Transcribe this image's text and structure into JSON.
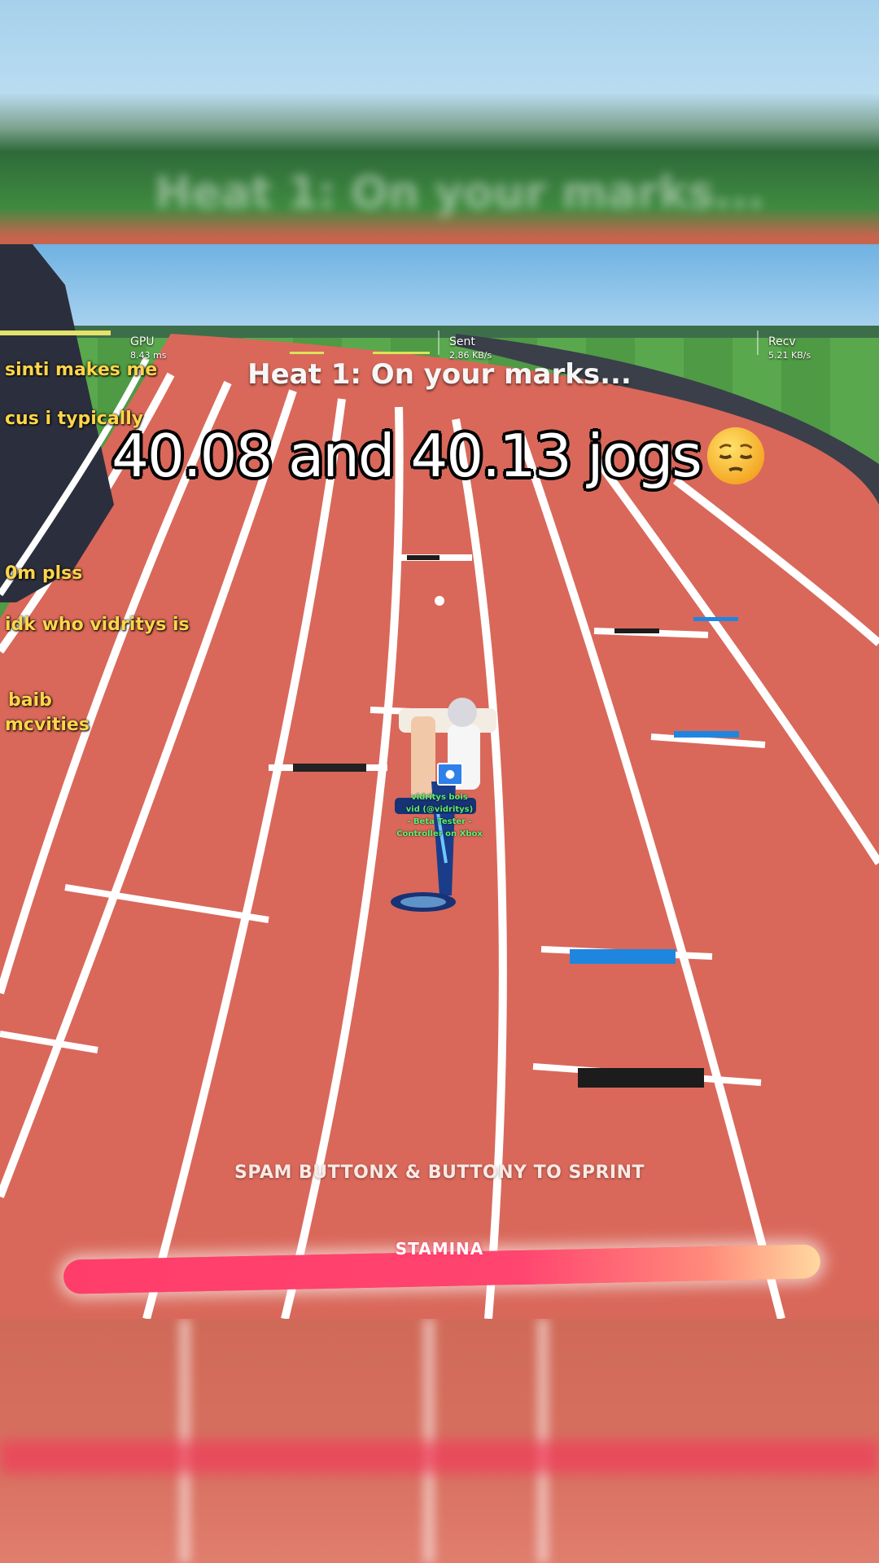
{
  "video": {
    "caption": "40.08 and 40.13 jogs",
    "caption_emoji": "relieved-face-emoji"
  },
  "blurred_header": {
    "ghost_text": "Heat 1: On your marks..."
  },
  "stats": {
    "gpu_label": "GPU",
    "gpu_value": "8.43 ms",
    "sent_label": "Sent",
    "sent_value": "2.86 KB/s",
    "recv_label": "Recv",
    "recv_value": "5.21 KB/s"
  },
  "game": {
    "heat_message": "Heat 1: On your marks...",
    "instruction": "SPAM BUTTONX & BUTTONY TO SPRINT",
    "stamina_label": "STAMINA"
  },
  "chat": [
    "sinti makes me",
    "cus i typically",
    "0m plss",
    "idk who vidritys is",
    "baib",
    "mcvities"
  ],
  "player": {
    "line1": "vidritys bois",
    "line2": "vid (@vidritys)",
    "line3": "- Beta Tester -",
    "line4": "Controller on Xbox",
    "badge_icon": "penguin-badge-icon"
  },
  "colors": {
    "track": "#d9685a",
    "lane_line": "#ffffff",
    "stamina": "#ff3d6a",
    "chat_text": "#ffd54a",
    "player_tag": "#5cf070"
  }
}
